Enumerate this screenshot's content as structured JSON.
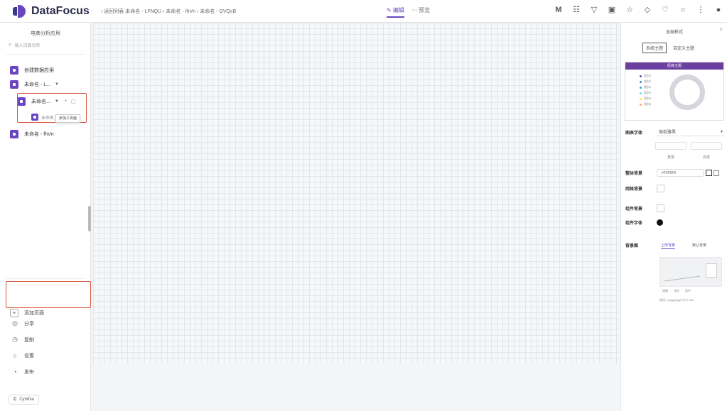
{
  "header": {
    "logo_text": "DataFocus",
    "breadcrumb": "‹ 返回列表  未命名 - LFNQU › 未命名 - fhVn › 未命名 - GVQcB",
    "mode_tabs": [
      {
        "label": "✎ 编辑",
        "active": true
      },
      {
        "label": "⋯ 预览",
        "active": false
      }
    ],
    "tool_icons": [
      "widget-icon",
      "layout-icon",
      "filter-icon",
      "save-icon",
      "star-icon",
      "shield-icon",
      "theme-icon",
      "settings-icon",
      "more-icon",
      "user-icon"
    ]
  },
  "sidebar": {
    "title": "电商分析应用",
    "search_placeholder": "输入页面名称",
    "pages": [
      {
        "label": "创建数据应用"
      },
      {
        "label": "未命名 - L..."
      },
      {
        "label": "未命名..."
      },
      {
        "label": "未命名 - fhVn"
      }
    ],
    "sub_item_label": "未命名",
    "tooltip": "添加子页面",
    "add_page_label": "添加页面",
    "links": [
      {
        "label": "分享",
        "icon": "share-icon"
      },
      {
        "label": "复制",
        "icon": "copy-icon"
      },
      {
        "label": "设置",
        "icon": "gear-icon"
      },
      {
        "label": "发布",
        "icon": "publish-icon"
      }
    ],
    "user": {
      "initial": "C",
      "name": "Cynthia"
    }
  },
  "right_panel": {
    "title": "全局样式",
    "tabs": [
      {
        "label": "系统主题",
        "active": true
      },
      {
        "label": "自定义主题",
        "active": false
      }
    ],
    "theme_card_title": "经典主题",
    "legend": [
      "类别1",
      "类别2",
      "类别3",
      "类别4",
      "类别5",
      "类别6"
    ],
    "legend_colors": [
      "#6b46c1",
      "#3d7fd9",
      "#37a2da",
      "#67e0e3",
      "#ffdb5c",
      "#ff9f7f"
    ],
    "font_label": "图表字体",
    "font_value": "微软雅黑",
    "width_label": "宽度",
    "height_label": "高度",
    "bg_color_label": "整体背景",
    "bg_color_value": "#F5F5F5",
    "grid_label": "网格背景",
    "gridline_label": "组件背景",
    "font_color_label": "组件字体",
    "bg_image_label": "背景图",
    "bg_tabs": [
      {
        "label": "上传背景",
        "active": true
      },
      {
        "label": "默认背景",
        "active": false
      }
    ],
    "bg_options": [
      "铺满",
      "适应",
      "居中"
    ],
    "bg_hint": "格式: png/jpeg/gif 大小: 5M"
  }
}
